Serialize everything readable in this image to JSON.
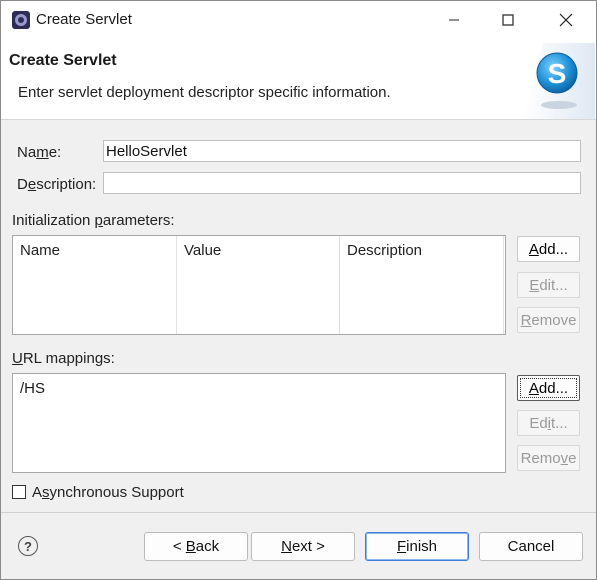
{
  "window": {
    "title": "Create Servlet",
    "controls": {
      "minimize": "minimize-icon",
      "maximize": "maximize-icon",
      "close": "close-icon"
    }
  },
  "banner": {
    "title": "Create Servlet",
    "description": "Enter servlet deployment descriptor specific information.",
    "logo_letter": "S"
  },
  "form": {
    "name_label_pre": "Na",
    "name_label_u": "m",
    "name_label_post": "e:",
    "name_value": "HelloServlet",
    "description_label_pre": "D",
    "description_label_u": "e",
    "description_label_post": "scription:",
    "description_value": ""
  },
  "init_params": {
    "label_pre": "Initialization ",
    "label_u": "p",
    "label_post": "arameters:",
    "columns": [
      "Name",
      "Value",
      "Description"
    ],
    "rows": [],
    "buttons": {
      "add_pre": "",
      "add_u": "A",
      "add_post": "dd...",
      "edit_pre": "",
      "edit_u": "E",
      "edit_post": "dit...",
      "remove_pre": "",
      "remove_u": "R",
      "remove_post": "emove"
    }
  },
  "url_mappings": {
    "label_pre": "",
    "label_u": "U",
    "label_post": "RL mappings:",
    "items": [
      "/HS"
    ],
    "buttons": {
      "add_pre": "",
      "add_u": "A",
      "add_post": "dd...",
      "edit_pre": "Ed",
      "edit_u": "i",
      "edit_post": "t...",
      "remove_pre": "Remo",
      "remove_u": "v",
      "remove_post": "e"
    }
  },
  "async": {
    "label_pre": "A",
    "label_u": "s",
    "label_post": "ynchronous Support",
    "checked": false
  },
  "footer": {
    "help_glyph": "?",
    "back_pre": "< ",
    "back_u": "B",
    "back_post": "ack",
    "next_pre": "",
    "next_u": "N",
    "next_post": "ext >",
    "finish_pre": "",
    "finish_u": "F",
    "finish_post": "inish",
    "cancel": "Cancel"
  },
  "colors": {
    "accent": "#3c7fd6",
    "logo_blue": "#1e90d6",
    "disabled_text": "#9a9a9a"
  }
}
